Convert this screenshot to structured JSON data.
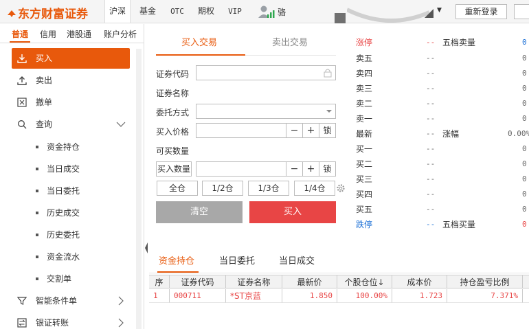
{
  "header": {
    "brand": "东方财富证券",
    "nav": [
      {
        "label": "沪深",
        "active": true
      },
      {
        "label": "基金",
        "active": false
      },
      {
        "label": "OTC",
        "active": false
      },
      {
        "label": "期权",
        "active": false
      },
      {
        "label": "VIP",
        "active": false
      }
    ],
    "user_name": "骆",
    "relogin_label": "重新登录"
  },
  "sidebar": {
    "tabs": [
      "普通",
      "信用",
      "港股通",
      "账户分析"
    ],
    "items": [
      {
        "label": "买入",
        "icon": "download-icon",
        "active": true
      },
      {
        "label": "卖出",
        "icon": "upload-icon",
        "active": false
      },
      {
        "label": "撤单",
        "icon": "cancel-box-icon",
        "active": false
      },
      {
        "label": "查询",
        "icon": "search-icon",
        "active": false
      }
    ],
    "sub_items": [
      "资金持仓",
      "当日成交",
      "当日委托",
      "历史成交",
      "历史委托",
      "资金流水",
      "交割单"
    ],
    "bottom_items": [
      {
        "label": "智能条件单",
        "icon": "filter-icon"
      },
      {
        "label": "银证转账",
        "icon": "transfer-icon"
      }
    ]
  },
  "order_form": {
    "tabs": {
      "buy": "买入交易",
      "sell": "卖出交易"
    },
    "code_label": "证券代码",
    "name_label": "证券名称",
    "order_type_label": "委托方式",
    "price_label": "买入价格",
    "available_label": "可买数量",
    "qty_label": "买入数量",
    "minus": "−",
    "plus": "+",
    "lock": "锁",
    "fractions": [
      "全仓",
      "1/2仓",
      "1/3仓",
      "1/4仓"
    ],
    "clear_label": "清空",
    "buy_label": "买入"
  },
  "quote": {
    "limit_up_label": "涨停",
    "limit_up_val": "--",
    "sell_depth_label": "五档卖量",
    "sell_levels": [
      {
        "label": "卖五",
        "price": "--",
        "vol": "0"
      },
      {
        "label": "卖四",
        "price": "--",
        "vol": "0"
      },
      {
        "label": "卖三",
        "price": "--",
        "vol": "0"
      },
      {
        "label": "卖二",
        "price": "--",
        "vol": "0"
      },
      {
        "label": "卖一",
        "price": "--",
        "vol": "0"
      }
    ],
    "sell_depth_vol": "0",
    "last_label": "最新",
    "last_val": "--",
    "change_label": "涨幅",
    "change_val": "0.00%",
    "buy_levels": [
      {
        "label": "买一",
        "price": "--",
        "vol": "0"
      },
      {
        "label": "买二",
        "price": "--",
        "vol": "0"
      },
      {
        "label": "买三",
        "price": "--",
        "vol": "0"
      },
      {
        "label": "买四",
        "price": "--",
        "vol": "0"
      },
      {
        "label": "买五",
        "price": "--",
        "vol": "0"
      }
    ],
    "limit_down_label": "跌停",
    "limit_down_val": "--",
    "buy_depth_label": "五档买量",
    "buy_depth_vol": "0"
  },
  "positions": {
    "tabs": [
      "资金持仓",
      "当日委托",
      "当日成交"
    ],
    "columns": [
      "序",
      "证券代码",
      "证券名称",
      "最新价",
      "个股仓位↓",
      "成本价",
      "持仓盈亏比例"
    ],
    "rows": [
      {
        "seq": "1",
        "code": "000711",
        "name": "*ST京蓝",
        "last": "1.850",
        "weight": "100.00%",
        "cost": "1.723",
        "pnl_ratio": "7.371%"
      }
    ]
  },
  "colors": {
    "accent": "#e8590c",
    "buy": "#e84545",
    "sell_blue": "#1a6fd6",
    "clear_gray": "#a8a8a8"
  }
}
